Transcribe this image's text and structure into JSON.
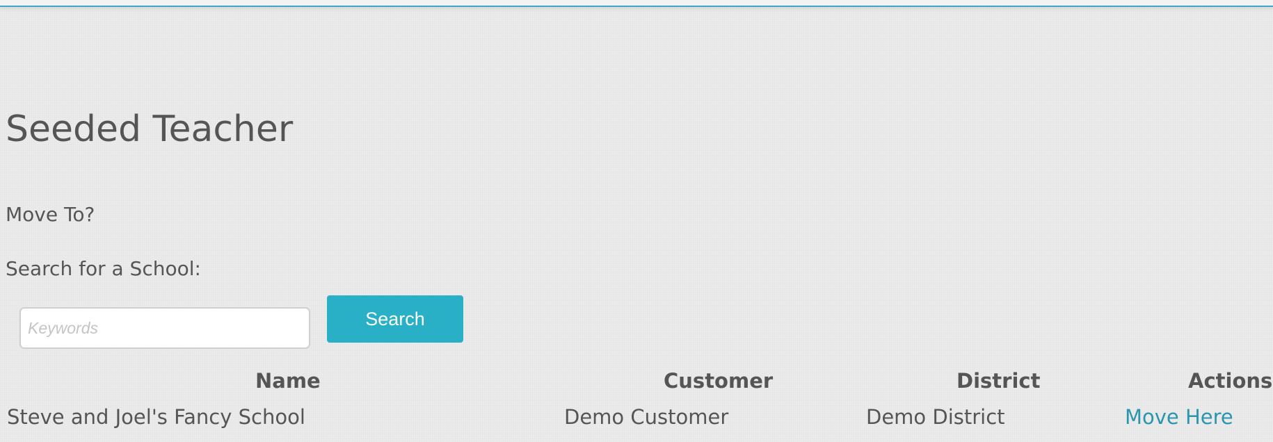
{
  "page": {
    "title": "Seeded Teacher",
    "move_to_label": "Move To?",
    "search_label": "Search for a School:"
  },
  "search": {
    "placeholder": "Keywords",
    "value": "",
    "button_label": "Search"
  },
  "table": {
    "columns": [
      "Name",
      "Customer",
      "District",
      "Actions"
    ],
    "rows": [
      {
        "name": "Steve and Joel's Fancy School",
        "customer": "Demo Customer",
        "district": "Demo District",
        "action": "Move Here"
      }
    ]
  },
  "colors": {
    "accent": "#29b0c6",
    "link": "#2a95ae",
    "text": "#555555",
    "background": "#e9e9e9"
  }
}
